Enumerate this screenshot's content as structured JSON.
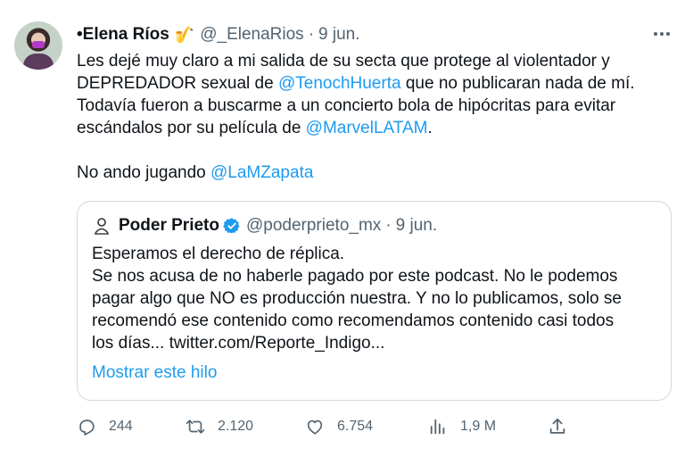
{
  "tweet": {
    "author": {
      "display_name": "•Elena Ríos",
      "emoji": "🎷",
      "handle": "@_ElenaRios",
      "separator": "·",
      "date": "9 jun."
    },
    "more_icon": "more-horizontal-icon",
    "text": {
      "line1": "Les dejé muy claro a mi salida de su secta que protege al violentador y",
      "line2_before": "DEPREDADOR sexual de ",
      "line2_mention": "@TenochHuerta",
      "line2_after": " que no publicaran nada de mí.",
      "line3": "Todavía fueron a buscarme a un concierto bola de hipócritas para evitar",
      "line4_before": "escándalos por su película de ",
      "line4_mention": "@MarvelLATAM",
      "line4_after": ".",
      "line5_before": "No ando jugando ",
      "line5_mention": "@LaMZapata"
    },
    "quote": {
      "display_name": "Poder Prieto",
      "verified_icon": "verified-badge-icon",
      "handle": "@poderprieto_mx",
      "separator": "·",
      "date": "9 jun.",
      "lines": [
        "Esperamos el derecho de réplica.",
        "Se nos acusa de no haberle pagado por este podcast. No le podemos",
        "pagar algo que NO es producción nuestra. Y no lo publicamos, solo se",
        "recomendó ese contenido como recomendamos contenido casi todos",
        "los días... twitter.com/Reporte_Indigo..."
      ],
      "show_thread": "Mostrar este hilo"
    },
    "actions": {
      "replies": "244",
      "retweets": "2.120",
      "likes": "6.754",
      "views": "1,9 M"
    }
  },
  "colors": {
    "accent": "#1d9bf0",
    "text": "#0f1419",
    "muted": "#536471",
    "border": "#cfd9de"
  }
}
